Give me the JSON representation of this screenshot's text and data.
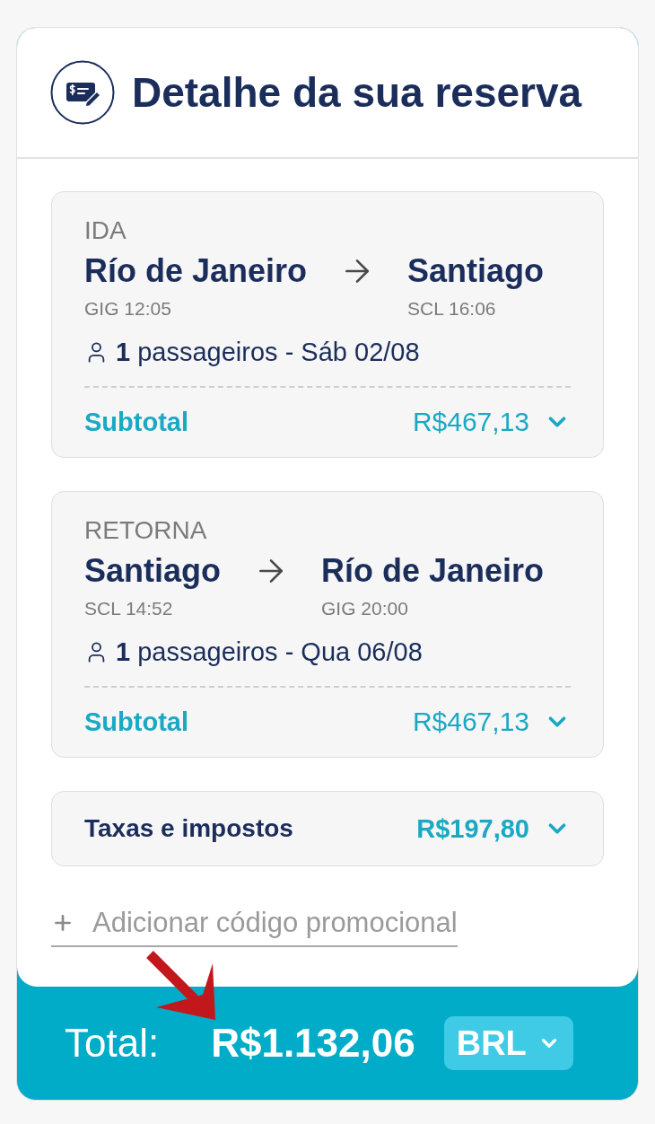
{
  "header": {
    "title": "Detalhe da sua reserva"
  },
  "legs": [
    {
      "label": "IDA",
      "origin": {
        "city": "Río de Janeiro",
        "code_time": "GIG 12:05"
      },
      "destination": {
        "city": "Santiago",
        "code_time": "SCL 16:06"
      },
      "passengers": "**1** passageiros - Sáb 02/08",
      "subtotal_label": "Subtotal",
      "subtotal": "R$467,13",
      "expanded": false
    },
    {
      "label": "RETORNA",
      "origin": {
        "city": "Santiago",
        "code_time": "SCL 14:52"
      },
      "destination": {
        "city": "Río de Janeiro",
        "code_time": "GIG 20:00"
      },
      "passengers": "**1** passageiros - Qua 06/08",
      "subtotal_label": "Subtotal",
      "subtotal": "R$467,13",
      "expanded": false
    }
  ],
  "taxes": {
    "label": "Taxas e impostos",
    "amount": "R$197,80",
    "expanded": false
  },
  "promo_code": {
    "label": "Adicionar código promocional"
  },
  "total": {
    "label": "Total:",
    "amount": "R$1.132,06",
    "currency": "BRL"
  }
}
